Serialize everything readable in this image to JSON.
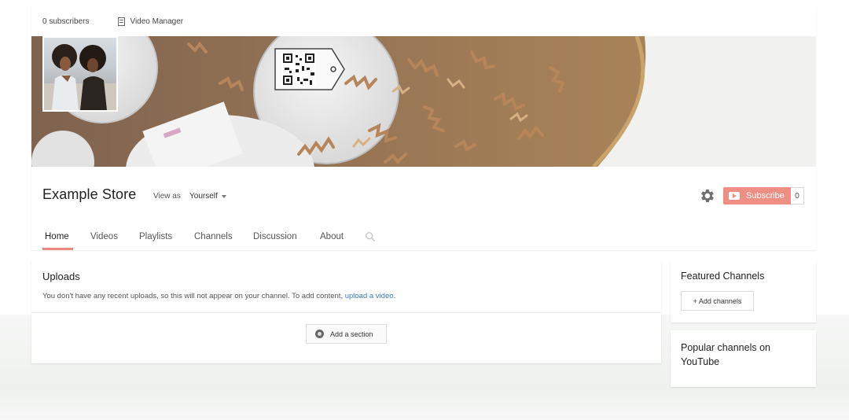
{
  "topbar": {
    "subscribers": "0 subscribers",
    "video_manager": "Video Manager"
  },
  "channel": {
    "title": "Example Store",
    "view_as_label": "View as",
    "view_as_value": "Yourself",
    "subscribe_label": "Subscribe",
    "subscriber_count": "0"
  },
  "tabs": [
    {
      "label": "Home",
      "active": true
    },
    {
      "label": "Videos"
    },
    {
      "label": "Playlists"
    },
    {
      "label": "Channels"
    },
    {
      "label": "Discussion"
    },
    {
      "label": "About"
    }
  ],
  "uploads": {
    "title": "Uploads",
    "message": "You don't have any recent uploads, so this will not appear on your channel. To add content,",
    "link": "upload a video",
    "link_suffix": ".",
    "add_section": "Add a section"
  },
  "sidebar": {
    "featured_title": "Featured Channels",
    "add_channels": "+ Add channels",
    "popular_title": "Popular channels on YouTube"
  },
  "colors": {
    "accent": "#ec8a80",
    "subscribe_bg": "#ef8f84",
    "link": "#3a7bc8"
  },
  "icons": {
    "video_manager": "video-manager-icon",
    "settings": "gear-icon",
    "subscribe": "youtube-play-icon",
    "search": "search-icon",
    "add_section": "add-circle-icon"
  }
}
